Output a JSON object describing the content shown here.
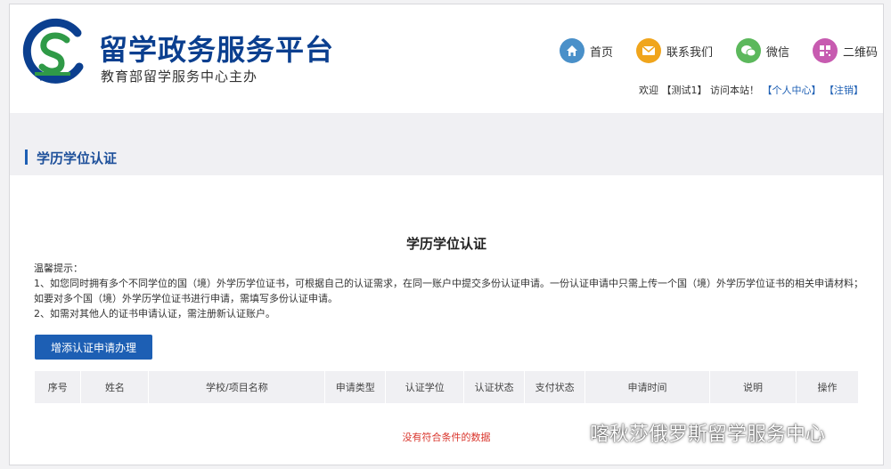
{
  "header": {
    "title": "留学政务服务平台",
    "subtitle": "教育部留学服务中心主办"
  },
  "nav": [
    {
      "label": "首页",
      "icon": "home-icon",
      "color": "#4a90c9"
    },
    {
      "label": "联系我们",
      "icon": "mail-icon",
      "color": "#f0a51c"
    },
    {
      "label": "微信",
      "icon": "wechat-icon",
      "color": "#5cb85c"
    },
    {
      "label": "二维码",
      "icon": "qrcode-icon",
      "color": "#c75bb0"
    }
  ],
  "welcome": {
    "prefix": "欢迎",
    "user": "【测试1】",
    "visit": "访问本站！",
    "profile_link": "【个人中心】",
    "logout_link": "【注销】"
  },
  "section": {
    "title": "学历学位认证"
  },
  "main": {
    "page_title": "学历学位认证",
    "tips_heading": "温馨提示：",
    "tip1": "1、如您同时拥有多个不同学位的国（境）外学历学位证书，可根据自己的认证需求，在同一账户中提交多份认证申请。一份认证申请中只需上传一个国（境）外学历学位证书的相关申请材料；如要对多个国（境）外学历学位证书进行申请，需填写多份认证申请。",
    "tip2": "2、如需对其他人的证书申请认证，需注册新认证账户。",
    "add_button": "增添认证申请办理"
  },
  "table": {
    "columns": [
      "序号",
      "姓名",
      "学校/项目名称",
      "申请类型",
      "认证学位",
      "认证状态",
      "支付状态",
      "申请时间",
      "说明",
      "操作"
    ],
    "empty_text": "没有符合条件的数据"
  },
  "watermark": {
    "text": "喀秋莎俄罗斯留学服务中心"
  },
  "colors": {
    "brand": "#0b3f8f",
    "accent": "#1d5fb4",
    "empty": "#d9342b"
  }
}
